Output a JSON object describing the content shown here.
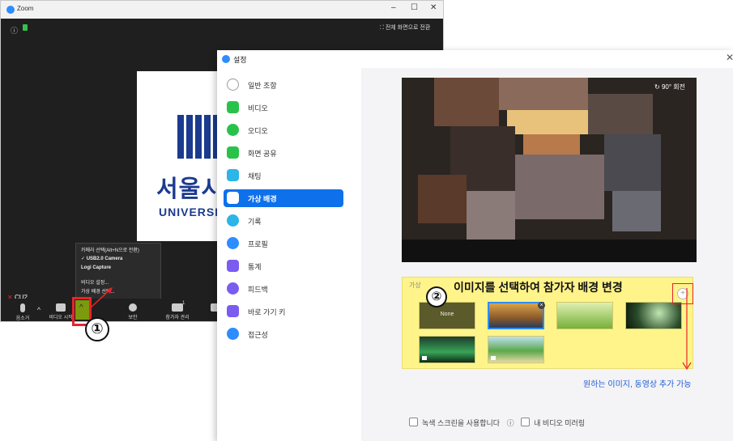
{
  "zoom_window": {
    "title": "Zoom",
    "fullscreen_label": "전체 화면으로 전환",
    "slide": {
      "korean_text": "서울시",
      "english_text": "UNIVERSIT"
    },
    "participant_name": "CU2",
    "video_menu": [
      "카메라 선택(Alt+N으로 전환)",
      "✓ USB2.0 Camera",
      "Logi Capture",
      "비디오 설정...",
      "가상 배경 선택..."
    ],
    "toolbar": {
      "mute_label": "음소거",
      "video_label": "비디오 시작",
      "security_label": "보안",
      "participants_label": "참가자 관리",
      "participants_count": "1"
    },
    "step1_marker": "①"
  },
  "settings_window": {
    "title": "설정",
    "close_icon": "close-icon",
    "sidebar": [
      {
        "label": "일반 조항",
        "color": "#9b9b9b",
        "active": false
      },
      {
        "label": "비디오",
        "color": "#28c24b",
        "active": false
      },
      {
        "label": "오디오",
        "color": "#28c24b",
        "active": false
      },
      {
        "label": "화면 공유",
        "color": "#28c24b",
        "active": false
      },
      {
        "label": "채팅",
        "color": "#2bb5e8",
        "active": false
      },
      {
        "label": "가상 배경",
        "color": "#0e71eb",
        "active": true
      },
      {
        "label": "기록",
        "color": "#2bb5e8",
        "active": false
      },
      {
        "label": "프로필",
        "color": "#2d8cff",
        "active": false
      },
      {
        "label": "통계",
        "color": "#7a5cf0",
        "active": false
      },
      {
        "label": "피드백",
        "color": "#7a5cf0",
        "active": false
      },
      {
        "label": "바로 가기 키",
        "color": "#7a5cf0",
        "active": false
      },
      {
        "label": "접근성",
        "color": "#2d8cff",
        "active": false
      }
    ],
    "preview": {
      "rotate_label": "90° 회전"
    },
    "background_section_label": "가상",
    "thumbnails": [
      {
        "label": "None"
      },
      {
        "label": ""
      },
      {
        "label": ""
      },
      {
        "label": ""
      },
      {
        "label": ""
      },
      {
        "label": ""
      }
    ],
    "step2_marker": "②",
    "step2_text": "이미지를 선택하여 참가자 배경 변경",
    "add_button": "+",
    "add_note": "원하는 이미지, 동영상 추가 가능",
    "options": {
      "green_screen_label": "녹색 스크린을 사용합니다",
      "mirror_label": "내 비디오 미러링"
    }
  }
}
